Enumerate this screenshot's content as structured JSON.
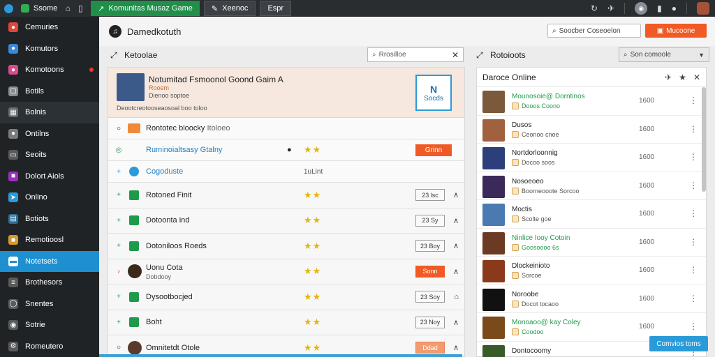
{
  "topbar": {
    "app_name": "Ssome",
    "tabs": [
      {
        "label": "Komunitas Musaz Game",
        "icon": "↗"
      },
      {
        "label": "Xeenoc",
        "icon": "✎"
      },
      {
        "label": "Espr",
        "icon": ""
      }
    ]
  },
  "sidebar": {
    "items": [
      {
        "label": "Cemuries",
        "icon": "users-icon",
        "color": "#e0463b"
      },
      {
        "label": "Komutors",
        "icon": "globe-icon",
        "color": "#3a86d8"
      },
      {
        "label": "Komotoons",
        "icon": "chat-icon",
        "color": "#d94a8c"
      },
      {
        "label": "Botils",
        "icon": "box-icon",
        "color": "#8c8c8c"
      },
      {
        "label": "Bolnis",
        "icon": "grid-icon",
        "color": "#6b6b6b"
      },
      {
        "label": "Ontilns",
        "icon": "person-icon",
        "color": "#7b7b7b"
      },
      {
        "label": "Seoits",
        "icon": "monitor-icon",
        "color": "#5a5a5a"
      },
      {
        "label": "Dolort Aiols",
        "icon": "puzzle-icon",
        "color": "#9b2fc0"
      },
      {
        "label": "Onlino",
        "icon": "arrow-icon",
        "color": "#2a9bd8"
      },
      {
        "label": "Botiots",
        "icon": "card-icon",
        "color": "#2a6f9b"
      },
      {
        "label": "Remotioosl",
        "icon": "gift-icon",
        "color": "#d49a2a"
      },
      {
        "label": "Notetsets",
        "icon": "folder-icon",
        "color": "#ffffff"
      },
      {
        "label": "Brothesors",
        "icon": "list-icon",
        "color": "#5a5a5a"
      },
      {
        "label": "Snentes",
        "icon": "chat-icon",
        "color": "#5a5a5a"
      },
      {
        "label": "Sotrie",
        "icon": "circle-icon",
        "color": "#5a5a5a"
      },
      {
        "label": "Romeutero",
        "icon": "settings-icon",
        "color": "#5a5a5a"
      }
    ],
    "active_index": 11
  },
  "header": {
    "title": "Damedkotuth",
    "search_placeholder": "Soocber Coseoelon",
    "action_label": "Mucoone"
  },
  "center": {
    "title": "Ketoolae",
    "search_placeholder": "Rrosilloe",
    "feature": {
      "title": "Notumitad Fsmoonol Goond Gaim A",
      "tag": "Rooem",
      "sub": "Dienoo soptoe",
      "desc": "Deootcreotooseaosoal boo toloo",
      "box_label": "Socds"
    },
    "top_rows": [
      {
        "label": "Rontotec bloocky",
        "extra": "Itoloeo"
      },
      {
        "label": "Ruminoialtsasy Gtalny",
        "button": "Grinn"
      },
      {
        "label": "Cogoduste",
        "count": "1uLint"
      }
    ],
    "rows": [
      {
        "label": "Rotoned Finit",
        "box": "23 lsc",
        "box_style": "normal"
      },
      {
        "label": "Dotoonta ind",
        "box": "23 Sy",
        "box_style": "normal"
      },
      {
        "label": "Dotoniloos Roeds",
        "box": "23 Boy",
        "box_style": "normal"
      },
      {
        "label": "Uonu Cota",
        "sub": "Dobdooy",
        "box": "Sonn",
        "box_style": "orange"
      },
      {
        "label": "Dysootbocjed",
        "box": "23 Soy",
        "box_style": "normal"
      },
      {
        "label": "Boht",
        "box": "23 Noy",
        "box_style": "normal"
      },
      {
        "label": "Omnitetdt Otole",
        "box": "Ddad",
        "box_style": "peach"
      }
    ]
  },
  "right": {
    "title": "Rotoioots",
    "select_label": "Son comoole",
    "panel_title": "Daroce Online",
    "items": [
      {
        "name": "Mounosoie@ Dorntinos",
        "sub": "Dooos Coono",
        "value": "1600",
        "green": true,
        "color": "#7a5a3a"
      },
      {
        "name": "Dusos",
        "sub": "Ceonoo cnoe",
        "value": "1600",
        "green": false,
        "color": "#a2613e"
      },
      {
        "name": "Nortdorloonnig",
        "sub": "Docoo soos",
        "value": "1600",
        "green": false,
        "color": "#2c3f7a"
      },
      {
        "name": "Nosoeoeo",
        "sub": "Boorneooote Sorcoo",
        "value": "1600",
        "green": false,
        "color": "#3a2a5a"
      },
      {
        "name": "Moctis",
        "sub": "Scolte goe",
        "value": "1600",
        "green": false,
        "color": "#4a7ab0"
      },
      {
        "name": "Ninlice Iooy Cotoin",
        "sub": "Goosoooo 6s",
        "value": "1600",
        "green": true,
        "color": "#6a3a22"
      },
      {
        "name": "Dlockeinioto",
        "sub": "Sorcoe",
        "value": "1600",
        "green": false,
        "color": "#8a3a1a"
      },
      {
        "name": "Noroobe",
        "sub": "Docot tocaoo",
        "value": "1600",
        "green": false,
        "color": "#111111"
      },
      {
        "name": "Monoaoo@ kay Coley",
        "sub": "Coodoo",
        "value": "1600",
        "green": true,
        "color": "#7a4a1a"
      },
      {
        "name": "Dontocoomy",
        "sub": "",
        "value": "",
        "green": false,
        "color": "#3a5a2a"
      }
    ],
    "float_button": "Comvios toms"
  }
}
